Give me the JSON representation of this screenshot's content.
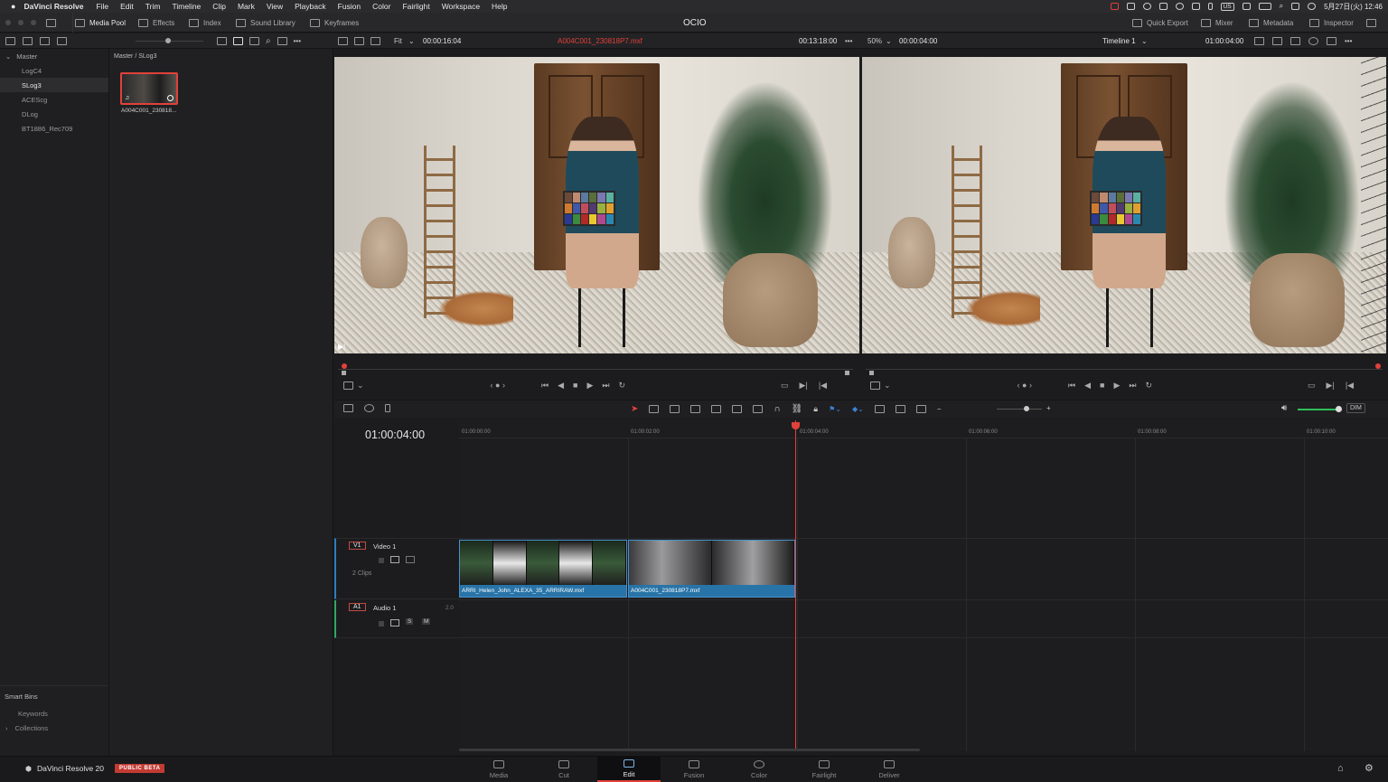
{
  "menubar": {
    "app": "DaVinci Resolve",
    "items": [
      "File",
      "Edit",
      "Trim",
      "Timeline",
      "Clip",
      "Mark",
      "View",
      "Playback",
      "Fusion",
      "Color",
      "Fairlight",
      "Workspace",
      "Help"
    ],
    "clock": "5月27日(火) 12:46",
    "input_source": "US"
  },
  "toolbar": {
    "media_pool": "Media Pool",
    "effects": "Effects",
    "index": "Index",
    "sound_library": "Sound Library",
    "keyframes": "Keyframes",
    "project_title": "OCIO",
    "quick_export": "Quick Export",
    "mixer": "Mixer",
    "metadata": "Metadata",
    "inspector": "Inspector"
  },
  "viewer_header": {
    "fit": "Fit",
    "source_duration": "00:00:16:04",
    "clip_name": "A004C001_230818P7.mxf",
    "source_timecode": "00:13:18:00",
    "zoom": "50%",
    "record_duration": "00:00:04:00",
    "timeline_name": "Timeline 1",
    "record_timecode": "01:00:04:00"
  },
  "bins": {
    "root": "Master",
    "items": [
      "LogC4",
      "SLog3",
      "ACEScg",
      "DLog",
      "BT1886_Rec709"
    ],
    "selected_index": 1
  },
  "smart_bins": {
    "title": "Smart Bins",
    "items": [
      "Keywords",
      "Collections"
    ]
  },
  "pool": {
    "breadcrumb": "Master / SLog3",
    "clip_label": "A004C001_230818..."
  },
  "timeline": {
    "timecode": "01:00:04:00",
    "ruler": [
      "01:00:00:00",
      "01:00:02:00",
      "01:00:04:00",
      "01:00:06:00",
      "01:00:08:00",
      "01:00:10:00"
    ],
    "video_track": {
      "tag": "V1",
      "name": "Video 1",
      "count": "2 Clips"
    },
    "audio_track": {
      "tag": "A1",
      "name": "Audio 1",
      "channels": "2.0",
      "solo": "S",
      "mute": "M"
    },
    "clips": [
      {
        "name": "ARRI_Helen_John_ALEXA_35_ARRIRAW.mxf"
      },
      {
        "name": "A004C001_230818P7.mxf"
      }
    ],
    "dim": "DIM"
  },
  "pages": [
    "Media",
    "Cut",
    "Edit",
    "Fusion",
    "Color",
    "Fairlight",
    "Deliver"
  ],
  "active_page": "Edit",
  "brand": {
    "name": "DaVinci Resolve 20",
    "badge": "PUBLIC BETA"
  },
  "colors": {
    "accent_red": "#e0413a",
    "clip_blue": "#2874a8",
    "active_blue": "#7db4e8"
  }
}
